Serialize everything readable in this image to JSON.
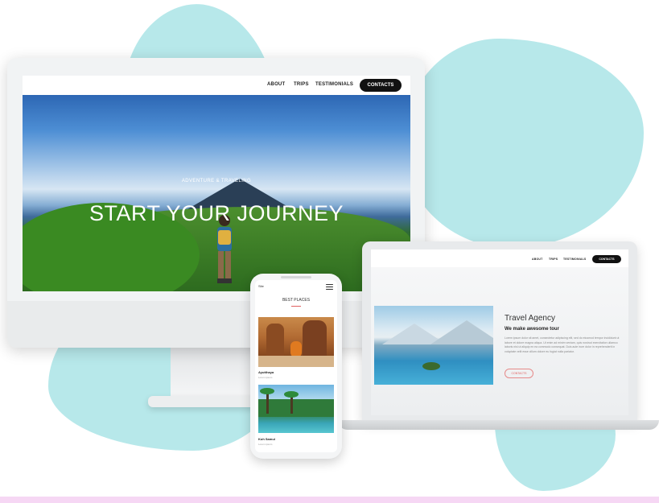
{
  "desktop": {
    "nav": {
      "links": [
        "ABOUT",
        "TRIPS",
        "TESTIMONIALS"
      ],
      "contacts_label": "CONTACTS"
    },
    "hero": {
      "subtitle": "ADVENTURE & TRAVELING",
      "title": "START YOUR JOURNEY"
    }
  },
  "laptop": {
    "nav": {
      "links": [
        "ABOUT",
        "TRIPS",
        "TESTIMONIALS"
      ],
      "contacts_label": "CONTACTS"
    },
    "title": "Travel Agency",
    "subtitle": "We make awesome tour",
    "body": "Lorem ipsum dolor sit amet, consectetur adipiscing elit, sed do eiusmod tempor incididunt ut labore et dolore magna aliqua. Ut enim ad minim veniam, quis nostrud exercitation ullamco laboris nisi ut aliquip ex ea commodo consequat. Duis aute irure dolor in reprehenderit in voluptate velit esse cillum dolore eu fugiat nulla pariatur.",
    "button_label": "CONTACTS"
  },
  "phone": {
    "logo": "Site",
    "section_title": "BEST PLACES",
    "cards": [
      {
        "title": "Ayutthaya",
        "caption": "Lorem ipsum"
      },
      {
        "title": "Koh Samui",
        "caption": "Lorem ipsum"
      }
    ]
  },
  "colors": {
    "blob": "#b7e8ea",
    "accent_red": "#e06060",
    "nav_pill": "#111111"
  }
}
